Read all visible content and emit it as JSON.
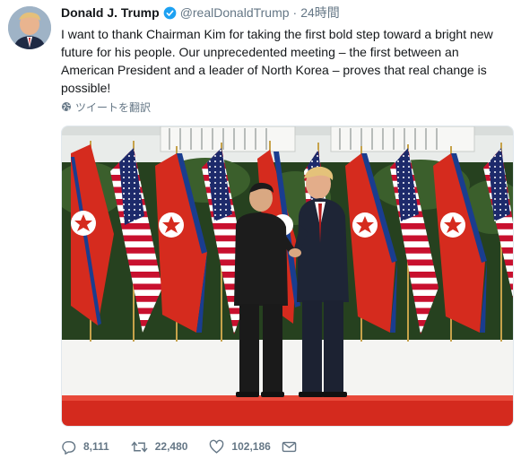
{
  "author": {
    "name": "Donald J. Trump",
    "handle": "@realDonaldTrump",
    "time": "24時間"
  },
  "tweet": {
    "text": "I want to thank Chairman Kim for taking the first bold step toward a bright new future for his people. Our unprecedented meeting – the first between an American President and a leader of North Korea – proves that real change is possible!",
    "translate_label": "ツイートを翻訳"
  },
  "actions": {
    "replies": "8,111",
    "retweets": "22,480",
    "likes": "102,186"
  },
  "icons": {
    "verified": "verified-badge-icon",
    "globe": "globe-icon",
    "reply": "reply-icon",
    "retweet": "retweet-icon",
    "like": "heart-icon",
    "dm": "envelope-icon"
  },
  "colors": {
    "verified_blue": "#1da1f2",
    "secondary_text": "#657786",
    "carpet_red": "#d42a1e"
  }
}
